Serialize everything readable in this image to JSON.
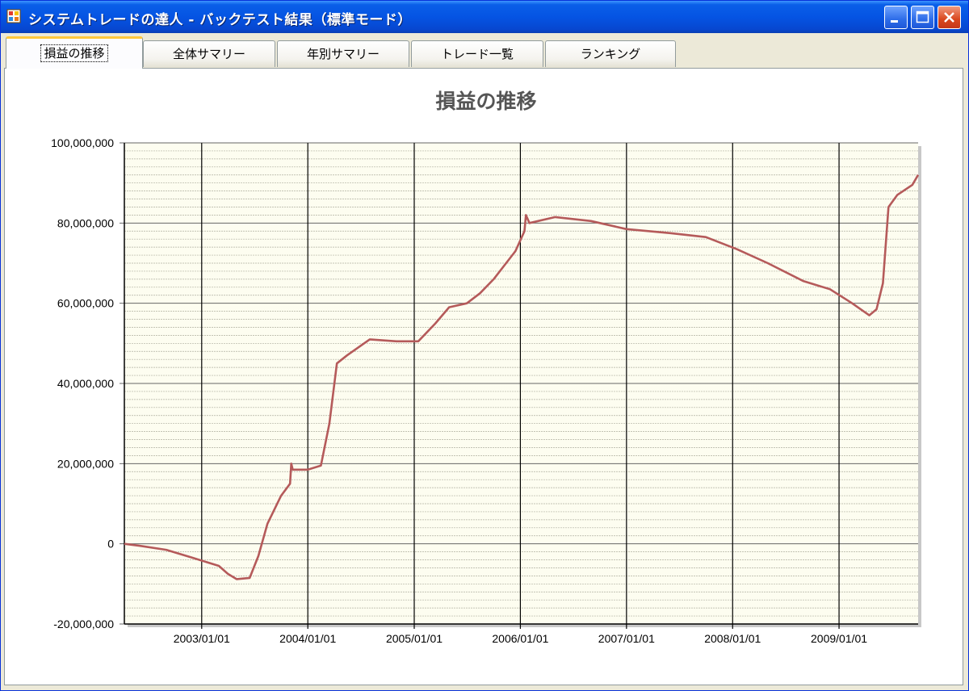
{
  "window": {
    "title": "システムトレードの達人 - バックテスト結果（標準モード）",
    "minimize_icon": "minimize-icon",
    "maximize_icon": "maximize-icon",
    "close_icon": "close-icon"
  },
  "tabs": [
    {
      "label": "損益の推移",
      "active": true
    },
    {
      "label": "全体サマリー",
      "active": false
    },
    {
      "label": "年別サマリー",
      "active": false
    },
    {
      "label": "トレード一覧",
      "active": false
    },
    {
      "label": "ランキング",
      "active": false
    }
  ],
  "colors": {
    "title_bar": "#0554e3",
    "plot_background": "#fdfdf0",
    "series_line": "#b55a5a",
    "grid_major": "#000000",
    "grid_minor": "#b0b0a0"
  },
  "chart_data": {
    "type": "line",
    "title": "損益の推移",
    "xlabel": "",
    "ylabel": "",
    "ylim": [
      -20000000,
      100000000
    ],
    "y_ticks": [
      "100,000,000",
      "80,000,000",
      "60,000,000",
      "40,000,000",
      "20,000,000",
      "0",
      "-20,000,000"
    ],
    "y_tick_values": [
      100000000,
      80000000,
      60000000,
      40000000,
      20000000,
      0,
      -20000000
    ],
    "x_ticks": [
      "2003/01/01",
      "2004/01/01",
      "2005/01/01",
      "2006/01/01",
      "2007/01/01",
      "2008/01/01",
      "2009/01/01"
    ],
    "xlim": [
      "2002/04/10",
      "2009/09/30"
    ],
    "grid": true,
    "series": [
      {
        "points": [
          [
            "2002/04/10",
            0
          ],
          [
            "2002/06/01",
            -500000
          ],
          [
            "2002/09/01",
            -1500000
          ],
          [
            "2002/12/01",
            -3500000
          ],
          [
            "2003/03/01",
            -5500000
          ],
          [
            "2003/04/01",
            -7500000
          ],
          [
            "2003/05/01",
            -8800000
          ],
          [
            "2003/06/15",
            -8500000
          ],
          [
            "2003/07/15",
            -3000000
          ],
          [
            "2003/08/15",
            5000000
          ],
          [
            "2003/10/01",
            12000000
          ],
          [
            "2003/11/01",
            15000000
          ],
          [
            "2003/11/05",
            20000000
          ],
          [
            "2003/11/10",
            18500000
          ],
          [
            "2004/01/01",
            18500000
          ],
          [
            "2004/02/15",
            19500000
          ],
          [
            "2004/03/15",
            30000000
          ],
          [
            "2004/04/10",
            45000000
          ],
          [
            "2004/05/15",
            47000000
          ],
          [
            "2004/08/01",
            51000000
          ],
          [
            "2004/11/01",
            50500000
          ],
          [
            "2005/01/15",
            50500000
          ],
          [
            "2005/03/15",
            55000000
          ],
          [
            "2005/05/01",
            59000000
          ],
          [
            "2005/07/01",
            60000000
          ],
          [
            "2005/08/15",
            62500000
          ],
          [
            "2005/10/01",
            66000000
          ],
          [
            "2005/12/15",
            73000000
          ],
          [
            "2006/01/15",
            78000000
          ],
          [
            "2006/01/20",
            82000000
          ],
          [
            "2006/02/01",
            80000000
          ],
          [
            "2006/05/01",
            81500000
          ],
          [
            "2006/09/01",
            80500000
          ],
          [
            "2007/01/01",
            78500000
          ],
          [
            "2007/06/01",
            77500000
          ],
          [
            "2007/10/01",
            76500000
          ],
          [
            "2008/01/15",
            73500000
          ],
          [
            "2008/05/01",
            70000000
          ],
          [
            "2008/09/01",
            65500000
          ],
          [
            "2008/12/01",
            63500000
          ],
          [
            "2009/02/15",
            60000000
          ],
          [
            "2009/04/15",
            57000000
          ],
          [
            "2009/05/10",
            58500000
          ],
          [
            "2009/06/01",
            65000000
          ],
          [
            "2009/06/20",
            84000000
          ],
          [
            "2009/07/20",
            87000000
          ],
          [
            "2009/09/10",
            89500000
          ],
          [
            "2009/09/30",
            92000000
          ]
        ]
      }
    ]
  }
}
